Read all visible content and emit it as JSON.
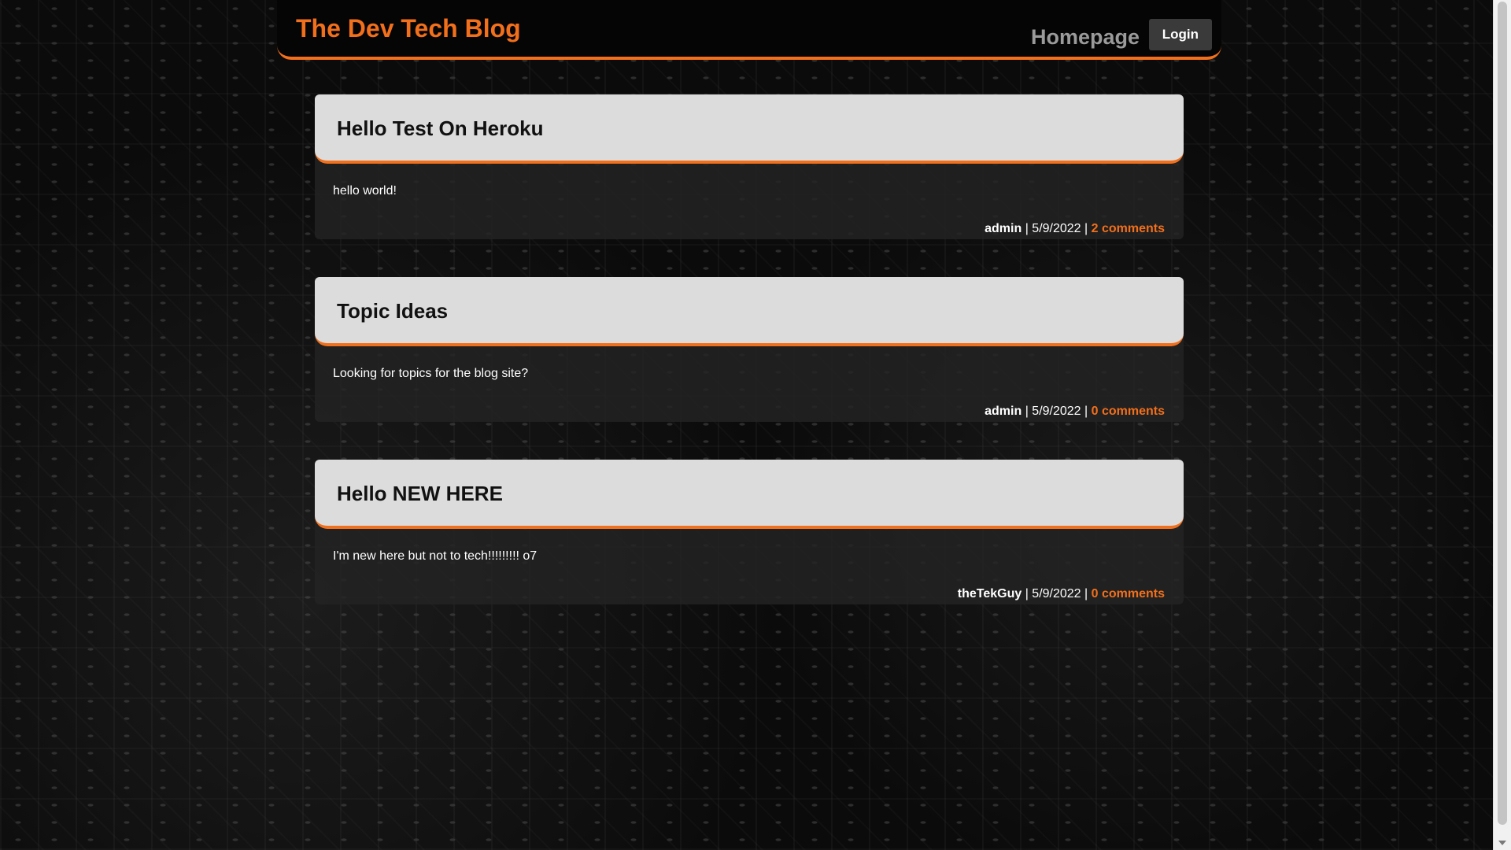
{
  "header": {
    "site_title": "The Dev Tech Blog",
    "nav_home": "Homepage",
    "nav_login": "Login"
  },
  "posts": [
    {
      "title": "Hello Test On Heroku",
      "content": "hello world!",
      "author": "admin",
      "date": "5/9/2022",
      "comments": "2 comments"
    },
    {
      "title": "Topic Ideas",
      "content": "Looking for topics for the blog site?",
      "author": "admin",
      "date": "5/9/2022",
      "comments": "0 comments"
    },
    {
      "title": "Hello NEW HERE",
      "content": "I'm new here but not to tech!!!!!!!!! o7",
      "author": "theTekGuy",
      "date": "5/9/2022",
      "comments": "0 comments"
    }
  ],
  "meta_separator": " | ",
  "colors": {
    "accent": "#f26f1b",
    "header_bg": "#050505",
    "card_header_bg": "#dcdcdc",
    "login_bg": "#3a3a3a"
  }
}
